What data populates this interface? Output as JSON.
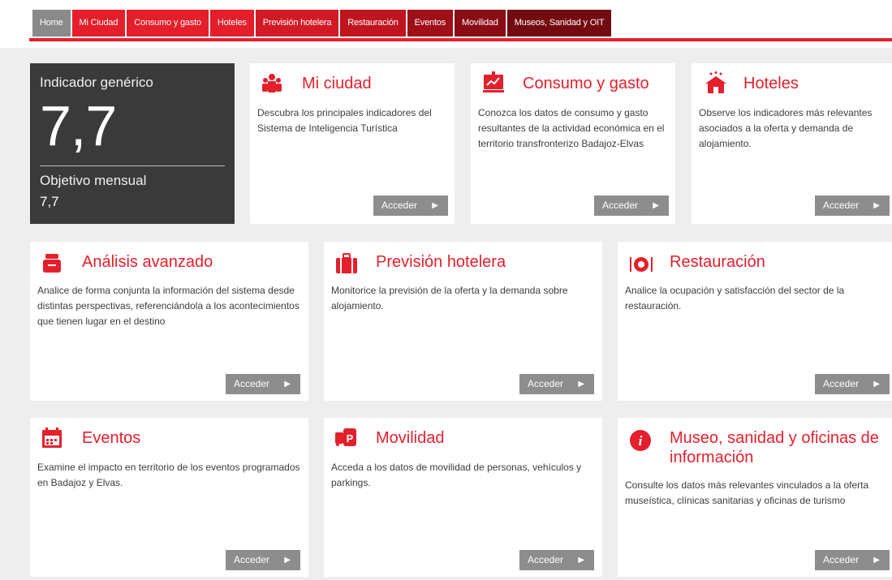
{
  "nav": {
    "items": [
      {
        "label": "Home",
        "color": "#8a8a8a"
      },
      {
        "label": "Mi Ciudad",
        "color": "#e41e2b"
      },
      {
        "label": "Consumo y gasto",
        "color": "#e41e2b"
      },
      {
        "label": "Hoteles",
        "color": "#e41e2b"
      },
      {
        "label": "Previsión hotelera",
        "color": "#d21a26"
      },
      {
        "label": "Restauración",
        "color": "#c0141f"
      },
      {
        "label": "Eventos",
        "color": "#9e0f18"
      },
      {
        "label": "Movilidad",
        "color": "#8a0c14"
      },
      {
        "label": "Museos, Sanidad y OIT",
        "color": "#740a11"
      }
    ]
  },
  "indicator": {
    "title": "Indicador genérico",
    "value": "7,7",
    "subtitle": "Objetivo mensual",
    "subvalue": "7,7"
  },
  "cards": {
    "ciudad": {
      "title": "Mi ciudad",
      "desc": "Descubra los principales indicadores del Sistema de Inteligencia Turística",
      "icon": "people-icon"
    },
    "consumo": {
      "title": "Consumo y gasto",
      "desc": "Conozca los datos de consumo y gasto resultantes de la actividad económica en el territorio transfronterizo Badajoz-Elvas",
      "icon": "chart-board-icon"
    },
    "hoteles": {
      "title": "Hoteles",
      "desc": "Observe los indicadores más relevantes asociados a la oferta y demanda de alojamiento.",
      "icon": "hotel-icon"
    },
    "analisis": {
      "title": "Análisis avanzado",
      "desc": "Analice de forma conjunta la información del sistema desde distintas perspectivas, referenciándola a los acontecimientos que tienen lugar en el destino",
      "icon": "stack-icon"
    },
    "prevision": {
      "title": "Previsión hotelera",
      "desc": "Monitorice la previsión de la oferta y la demanda sobre alojamiento.",
      "icon": "suitcase-icon"
    },
    "restauracion": {
      "title": "Restauración",
      "desc": "Analice la ocupación y satisfacción del sector de la restauración.",
      "icon": "dining-icon"
    },
    "eventos": {
      "title": "Eventos",
      "desc": "Examine el impacto en territorio de los eventos programados en Badajoz y Elvas.",
      "icon": "calendar-icon"
    },
    "movilidad": {
      "title": "Movilidad",
      "desc": "Acceda a los datos de movilidad de personas, vehículos y parkings.",
      "icon": "parking-icon"
    },
    "museo": {
      "title": "Museo, sanidad y oficinas de información",
      "desc": "Consulte los datos más relevantes vinculados a la oferta museística, clínicas sanitarias y oficinas de turismo",
      "icon": "info-icon"
    }
  },
  "button_label": "Acceder",
  "accent_color": "#e4202d"
}
